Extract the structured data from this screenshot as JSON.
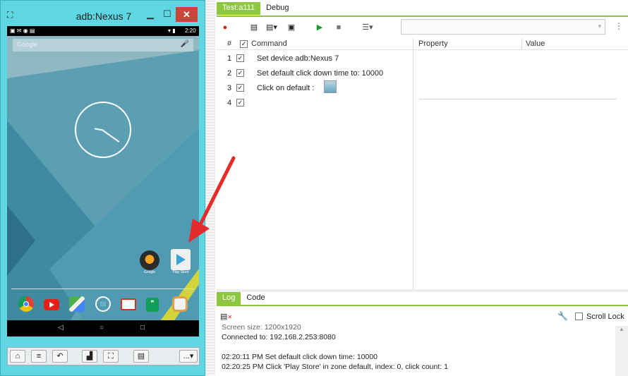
{
  "emulator": {
    "title": "adb:Nexus 7",
    "status_time": "2:20",
    "search_placeholder": "Google",
    "home_apps": [
      {
        "label": "Google",
        "icon": "google-apps-icon"
      },
      {
        "label": "Play Store",
        "icon": "play-store-icon"
      }
    ],
    "dock_icons": [
      "chrome-icon",
      "youtube-icon",
      "maps-icon",
      "app-drawer-icon",
      "gmail-icon",
      "hangouts-icon",
      "photos-icon"
    ],
    "nav": {
      "back": "◁",
      "home": "○",
      "recents": "□"
    },
    "toolbar_more": "..."
  },
  "tabs": {
    "test": "Test:a111",
    "debug": "Debug"
  },
  "grid": {
    "headers": {
      "index": "#",
      "command": "Command",
      "property": "Property",
      "value": "Value"
    },
    "rows": [
      {
        "n": "1",
        "text": "Set device  adb:Nexus 7"
      },
      {
        "n": "2",
        "text": "Set default click down time to:  10000"
      },
      {
        "n": "3",
        "text": "Click on  default :"
      },
      {
        "n": "4",
        "text": ""
      }
    ]
  },
  "log": {
    "tab_log": "Log",
    "tab_code": "Code",
    "scroll_lock": "Scroll Lock",
    "lines": [
      "Screen size: 1200x1920",
      "Connected to: 192.168.2.253:8080",
      "",
      "02:20:11 PM Set default click down time: 10000",
      "02:20:25 PM Click 'Play Store' in zone default, index: 0, click count: 1"
    ]
  },
  "colors": {
    "accent": "#8dc63f",
    "emulator_frame": "#5fd7e3",
    "arrow": "#e52b2b"
  }
}
